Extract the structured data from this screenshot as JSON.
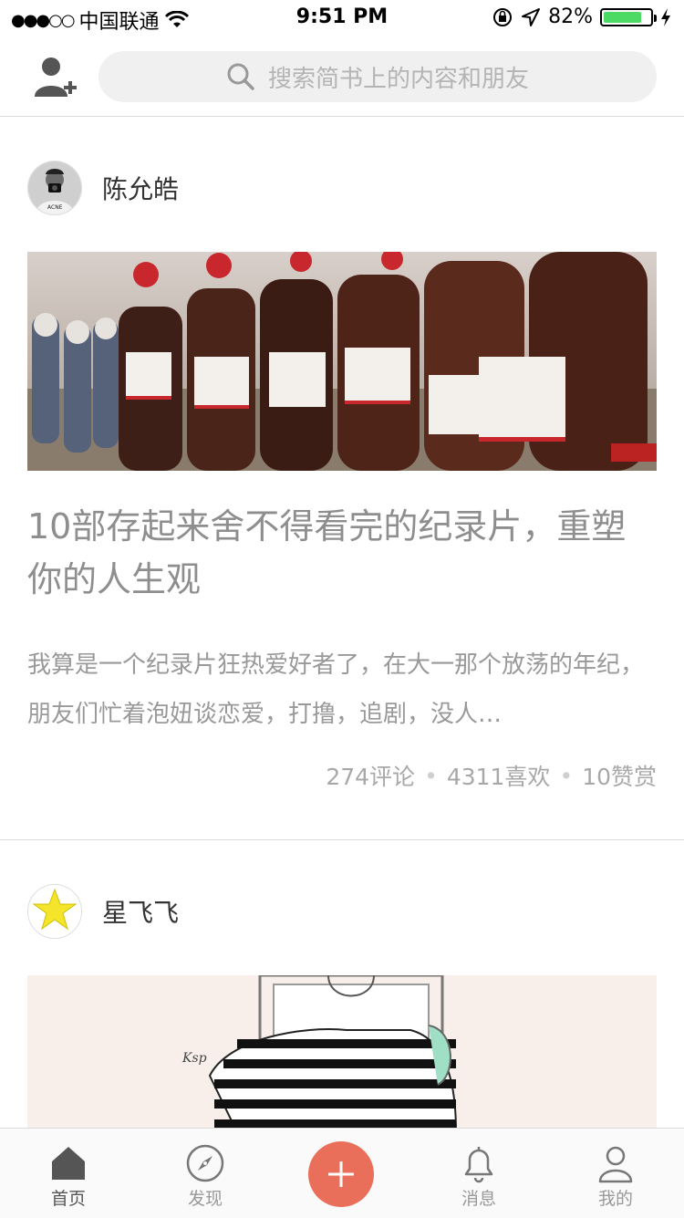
{
  "status_bar": {
    "signal": "●●●○○",
    "carrier": "中国联通",
    "time": "9:51 PM",
    "battery_percent": "82%",
    "battery_level": 0.82
  },
  "header": {
    "add_friend_icon": "add-user-icon",
    "search_placeholder": "搜索简书上的内容和朋友"
  },
  "feed": [
    {
      "author": "陈允皓",
      "title": "10部存起来舍不得看完的纪录片，重塑你的人生观",
      "excerpt": "我算是一个纪录片狂热爱好者了，在大一那个放荡的年纪，朋友们忙着泡妞谈恋爱，打撸，追剧，没人…",
      "comments": "274评论",
      "likes": "4311喜欢",
      "rewards": "10赞赏"
    },
    {
      "author": "星飞飞"
    }
  ],
  "tabbar": {
    "home": "首页",
    "discover": "发现",
    "messages": "消息",
    "me": "我的"
  },
  "colors": {
    "accent": "#ea6f5a",
    "battery": "#4cd964"
  }
}
